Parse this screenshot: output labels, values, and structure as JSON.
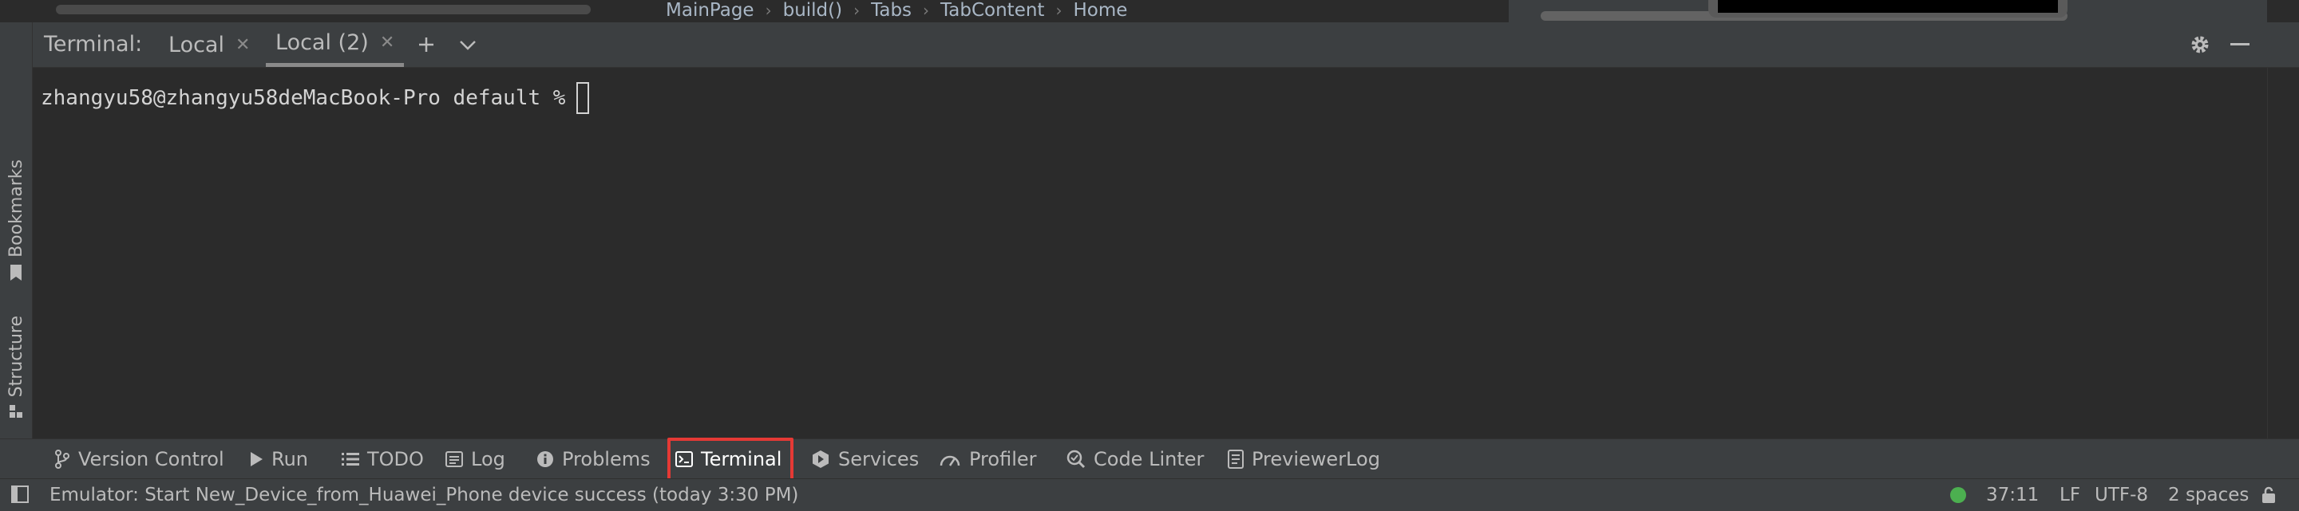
{
  "editor": {
    "breadcrumb": [
      "MainPage",
      "build()",
      "Tabs",
      "TabContent",
      "Home"
    ]
  },
  "left_stripe": {
    "bookmarks_label": "Bookmarks",
    "structure_label": "Structure"
  },
  "terminal": {
    "title": "Terminal:",
    "tabs": [
      {
        "label": "Local",
        "active": false
      },
      {
        "label": "Local (2)",
        "active": true
      }
    ],
    "prompt": "zhangyu58@zhangyu58deMacBook-Pro default %"
  },
  "tool_windows": [
    {
      "label": "Version Control",
      "icon": "branch-icon"
    },
    {
      "label": "Run",
      "icon": "play-icon"
    },
    {
      "label": "TODO",
      "icon": "list-icon"
    },
    {
      "label": "Log",
      "icon": "log-icon"
    },
    {
      "label": "Problems",
      "icon": "info-icon"
    },
    {
      "label": "Terminal",
      "icon": "terminal-icon",
      "selected": true
    },
    {
      "label": "Services",
      "icon": "services-icon"
    },
    {
      "label": "Profiler",
      "icon": "gauge-icon"
    },
    {
      "label": "Code Linter",
      "icon": "linter-icon"
    },
    {
      "label": "PreviewerLog",
      "icon": "document-icon"
    }
  ],
  "status": {
    "message": "Emulator: Start New_Device_from_Huawei_Phone device success (today 3:30 PM)",
    "position": "37:11",
    "line_separator": "LF",
    "encoding": "UTF-8",
    "indent": "2 spaces",
    "indicator_color": "#4caf50"
  },
  "colors": {
    "highlight": "#e53935",
    "background": "#2b2b2b",
    "panel": "#3c3f41"
  }
}
